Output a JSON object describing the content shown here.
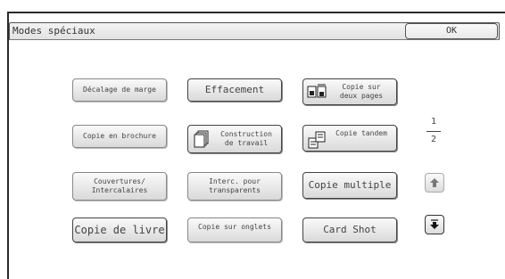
{
  "window": {
    "title": "Modes spéciaux",
    "ok_label": "OK"
  },
  "buttons": {
    "decalage": "Décalage de marge",
    "effacement": "Effacement",
    "copie_deux_pages": "Copie sur\ndeux pages",
    "brochure": "Copie en brochure",
    "construction": "Construction\nde travail",
    "copie_tandem": "Copie tandem",
    "couvertures": "Couvertures/\nIntercalaires",
    "interc_transparents": "Interc. pour\ntransparents",
    "copie_multiple": "Copie multiple",
    "copie_livre": "Copie de livre",
    "copie_onglets": "Copie sur onglets",
    "card_shot": "Card Shot"
  },
  "pagination": {
    "current": "1",
    "total": "2"
  },
  "icons": {
    "two_pages": "two-pages-icon",
    "job_build": "stacked-documents-icon",
    "tandem": "tandem-copy-icon",
    "up": "arrow-up-icon",
    "down": "arrow-down-icon"
  }
}
